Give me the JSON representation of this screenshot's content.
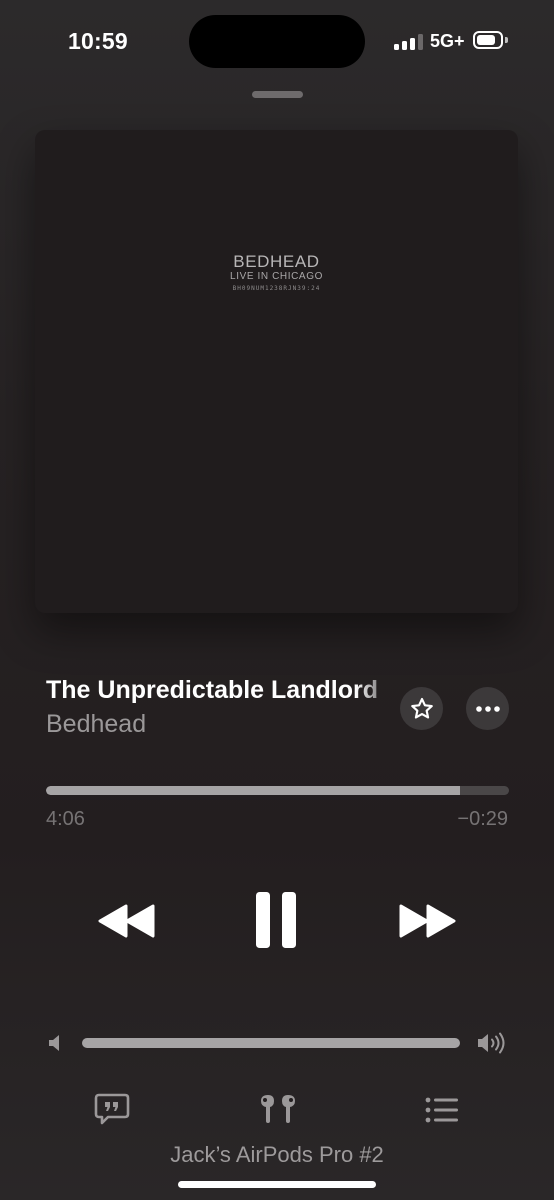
{
  "status_bar": {
    "time": "10:59",
    "network": "5G+",
    "signal_bars_active": 3,
    "signal_bars_total": 4,
    "battery_level": 0.8
  },
  "artwork": {
    "title": "BEDHEAD",
    "subtitle": "LIVE IN CHICAGO",
    "code": "BH09NUM1238RJN39:24"
  },
  "track": {
    "title": "The Unpredictable Landlord",
    "artist": "Bedhead"
  },
  "progress": {
    "elapsed": "4:06",
    "remaining": "−0:29",
    "fraction": 0.894
  },
  "volume": {
    "level": 1.0
  },
  "icons": {
    "favorite": "star-icon",
    "more": "ellipsis-icon",
    "rewind": "rewind-icon",
    "pause": "pause-icon",
    "forward": "fast-forward-icon",
    "volume_low": "speaker-icon",
    "volume_high": "speaker-wave-icon",
    "lyrics": "lyrics-quote-icon",
    "output": "airpods-icon",
    "queue": "queue-list-icon"
  },
  "output_device": "Jack’s AirPods Pro #2",
  "colors": {
    "background": "#262223",
    "accent": "#ffffff",
    "secondary_text": "#9b9899",
    "track_fill": "#a6a4a5"
  }
}
